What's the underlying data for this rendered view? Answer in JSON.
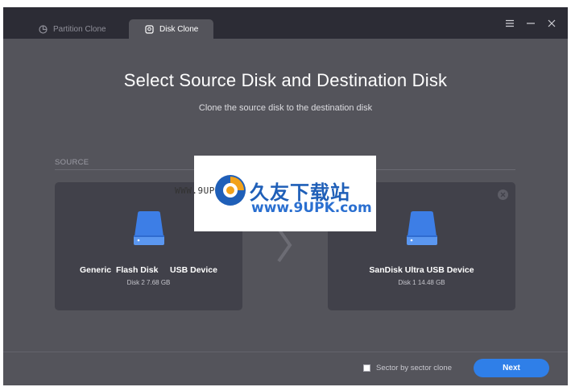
{
  "tabs": [
    {
      "label": "Partition Clone",
      "active": false,
      "icon": "pie-chart-icon"
    },
    {
      "label": "Disk Clone",
      "active": true,
      "icon": "disk-clone-icon"
    }
  ],
  "window_controls": [
    "menu-icon",
    "minimize-icon",
    "close-icon"
  ],
  "header": {
    "title": "Select Source Disk and Destination Disk",
    "subtitle": "Clone the source disk to the destination disk"
  },
  "source": {
    "section_label": "SOURCE",
    "disk_name": "Generic  Flash Disk     USB Device",
    "disk_info": "Disk 2 7.68 GB"
  },
  "destination": {
    "section_label": "",
    "disk_name": "SanDisk Ultra USB Device",
    "disk_info": "Disk 1 14.48 GB"
  },
  "footer": {
    "sector_clone_label": "Sector by sector clone",
    "sector_clone_checked": false,
    "next_label": "Next"
  },
  "watermark": {
    "cn_text": "久友下载站",
    "url_text": "www.9UPK.com",
    "url_left": "WWW.9UPK.COM"
  },
  "colors": {
    "accent": "#2f7fe8",
    "background": "#54545b",
    "titlebar": "#2c2c35",
    "card": "#41414a",
    "disk_icon": "#3d7ee6"
  }
}
